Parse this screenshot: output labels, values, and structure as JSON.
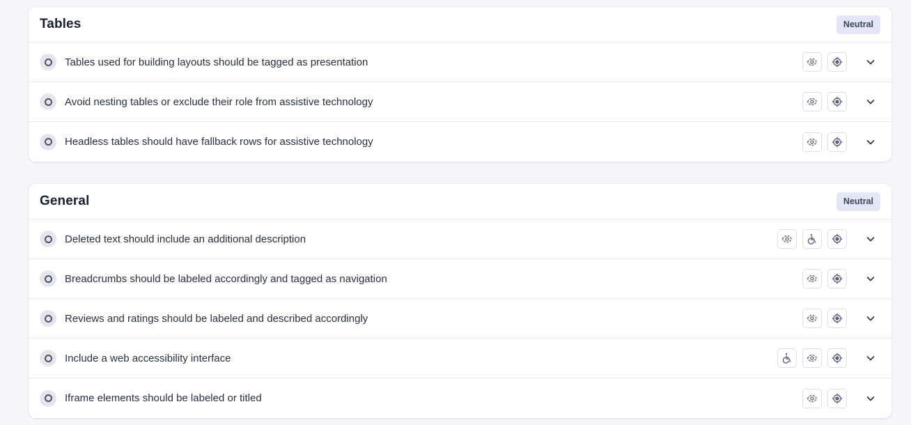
{
  "sections": [
    {
      "title": "Tables",
      "badge": "Neutral",
      "rules": [
        {
          "text": "Tables used for building layouts should be tagged as presentation",
          "icons": [
            "eye-icon",
            "target-icon"
          ]
        },
        {
          "text": "Avoid nesting tables or exclude their role from assistive technology",
          "icons": [
            "eye-icon",
            "target-icon"
          ]
        },
        {
          "text": "Headless tables should have fallback rows for assistive technology",
          "icons": [
            "eye-icon",
            "target-icon"
          ]
        }
      ]
    },
    {
      "title": "General",
      "badge": "Neutral",
      "rules": [
        {
          "text": "Deleted text should include an additional description",
          "icons": [
            "eye-icon",
            "wheelchair-icon",
            "target-icon"
          ]
        },
        {
          "text": "Breadcrumbs should be labeled accordingly and tagged as navigation",
          "icons": [
            "eye-icon",
            "target-icon"
          ]
        },
        {
          "text": "Reviews and ratings should be labeled and described accordingly",
          "icons": [
            "eye-icon",
            "target-icon"
          ]
        },
        {
          "text": "Include a web accessibility interface",
          "icons": [
            "wheelchair-icon",
            "eye-icon",
            "target-icon"
          ]
        },
        {
          "text": "Iframe elements should be labeled or titled",
          "icons": [
            "eye-icon",
            "target-icon"
          ]
        }
      ]
    }
  ],
  "colors": {
    "background": "#f5f6fa",
    "badge_bg": "#e2e6f5",
    "icon_stroke": "#5b6376"
  }
}
